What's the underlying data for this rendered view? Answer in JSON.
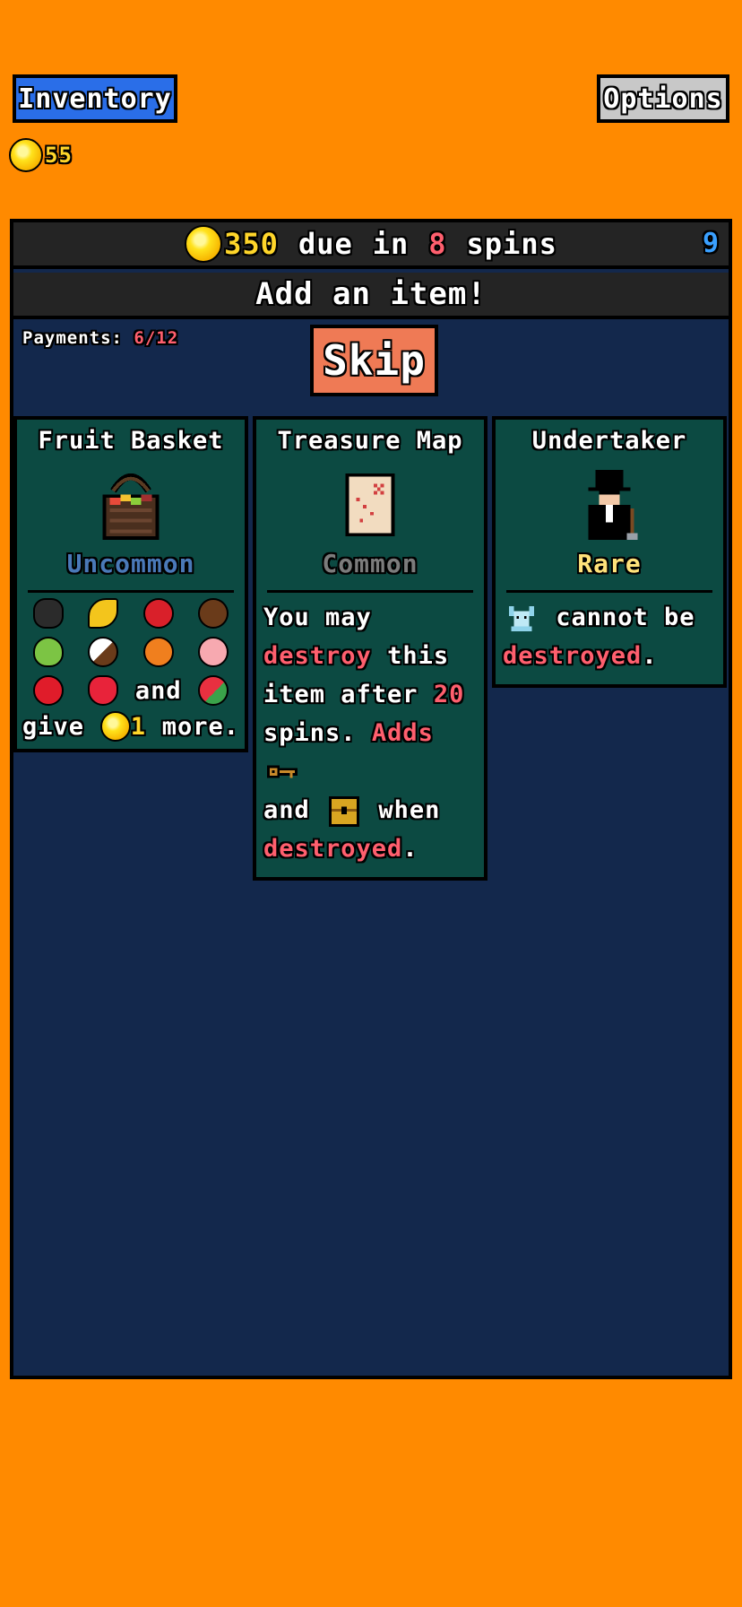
{
  "header": {
    "inventory_label": "Inventory",
    "options_label": "Options",
    "coins": "55"
  },
  "rent": {
    "amount": "350",
    "due_word": "due",
    "in_word": "in",
    "spins_left": "8",
    "spins_word": "spins",
    "rerolls": "9"
  },
  "prompt": "Add an item!",
  "payments": {
    "label": "Payments:",
    "value": "6/12"
  },
  "skip_label": "Skip",
  "cards": [
    {
      "title": "Fruit Basket",
      "rarity": "Uncommon",
      "rarity_color": "#4a79b8",
      "fruit_icons": [
        "durian-icon",
        "banana-icon",
        "cherry-icon",
        "coconut-icon",
        "pear-icon",
        "coconut-half-icon",
        "orange-icon",
        "peach-icon",
        "apple-icon",
        "strawberry-icon",
        "watermelon-icon"
      ],
      "and_word": "and",
      "give_word": "give",
      "give_amount": "1",
      "more_word": "more."
    },
    {
      "title": "Treasure Map",
      "rarity": "Common",
      "rarity_color": "#7c7c7c",
      "line1": "You may",
      "destroy": "destroy",
      "this_word": "this",
      "item_after": "item after",
      "spins_num": "20",
      "spins_word": "spins.",
      "adds": "Adds",
      "and_word": "and",
      "when_word": "when",
      "destroyed": "destroyed",
      "period": "."
    },
    {
      "title": "Undertaker",
      "rarity": "Rare",
      "rarity_color": "#ffe27a",
      "cannot_be": "cannot be",
      "destroyed": "destroyed",
      "period": "."
    }
  ],
  "colors": {
    "background": "#ff8a00",
    "panel": "#13284c",
    "card": "#0c4a42",
    "highlight_red": "#ff5f6e",
    "coin_yellow": "#ffd62a"
  }
}
